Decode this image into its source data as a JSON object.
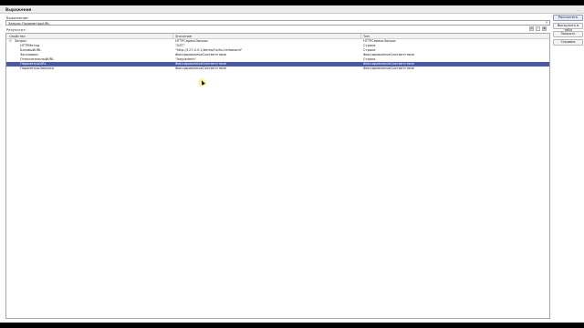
{
  "window": {
    "title": "Выражения",
    "more_label": "..."
  },
  "expression": {
    "label": "Выражение:",
    "value": "Запрос.ПараметрыURL",
    "clear_label": "×"
  },
  "result": {
    "label": "Результат:"
  },
  "columns": {
    "property": "Свойство",
    "value": "Значение",
    "type": "Тип"
  },
  "rows": [
    {
      "toggle": "⊟",
      "property": "Запрос",
      "value": "HTTPСервисЗапрос",
      "type": "HTTPСервисЗапрос"
    },
    {
      "toggle": "",
      "property": "HTTPМетод",
      "value": "\"GET\"",
      "type": "Строка"
    },
    {
      "toggle": "",
      "property": "БазовыйURL",
      "value": "\"http://127.0.0.1/demo/hs/hs-helloworld\"",
      "type": "Строка"
    },
    {
      "toggle": "",
      "property": "Заголовки",
      "value": "ФиксированноеСоответствие",
      "type": "ФиксированноеСоответствие"
    },
    {
      "toggle": "",
      "property": "ОтносительныйURL",
      "value": "\"/say/admin\"",
      "type": "Строка"
    },
    {
      "toggle": "",
      "property": "ПараметрыURL",
      "value": "ФиксированноеСоответствие",
      "type": "ФиксированноеСоответствие"
    },
    {
      "toggle": "",
      "property": "ПараметрыЗапроса",
      "value": "ФиксированноеСоответствие",
      "type": "ФиксированноеСоответствие"
    }
  ],
  "selected_row": 5,
  "buttons": {
    "calculate": "Рассчитать",
    "add_to_watch": "Выгрузить в табл",
    "close": "Закрыть",
    "help": "Справка"
  },
  "colors": {
    "selection": "#4a5aa8",
    "highlight": "#ffe650"
  }
}
